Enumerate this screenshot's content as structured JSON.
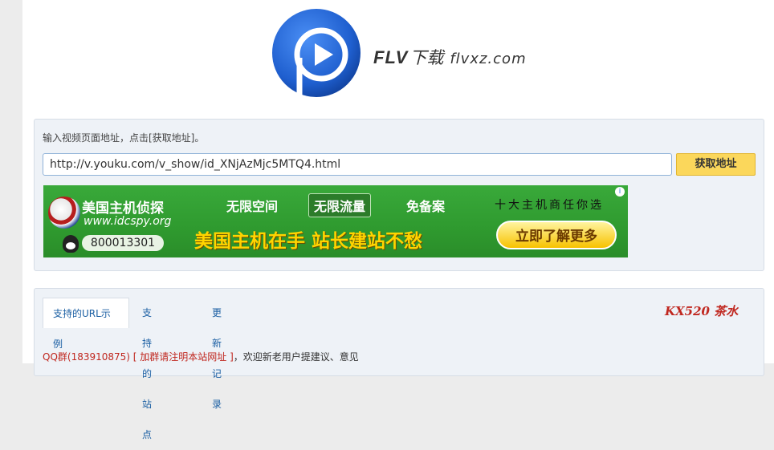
{
  "header": {
    "brand_main": "FLV",
    "brand_dl": "下载",
    "brand_domain": "flvxz.com",
    "logo": "flv-play-logo-icon",
    "logo_color": "#1f5fcf"
  },
  "form": {
    "hint": "输入视频页面地址，点击[获取地址]。",
    "url_value": "http://v.youku.com/v_show/id_XNjAzMjc5MTQ4.html",
    "submit_label": "获取地址"
  },
  "ad": {
    "title": "美国主机侦探",
    "site": "www.idcspy.org",
    "qq": "800013301",
    "features": [
      "无限空间",
      "无限流量",
      "免备案"
    ],
    "tag": "十大主机商任你选",
    "slogan": "美国主机在手 站长建站不愁",
    "cta": "立即了解更多",
    "info_icon": "i"
  },
  "tabs": [
    {
      "label": "支持的URL示例",
      "active": true
    },
    {
      "label": "支持的站点",
      "active": false
    },
    {
      "label": "更新记录",
      "active": false
    }
  ],
  "kx_logo": "KX520 茶水",
  "notice": {
    "qq_group": "QQ群(183910875)",
    "join_note": "[ 加群请注明本站网址 ]",
    "rest": "，欢迎新老用户提建议、意见"
  }
}
